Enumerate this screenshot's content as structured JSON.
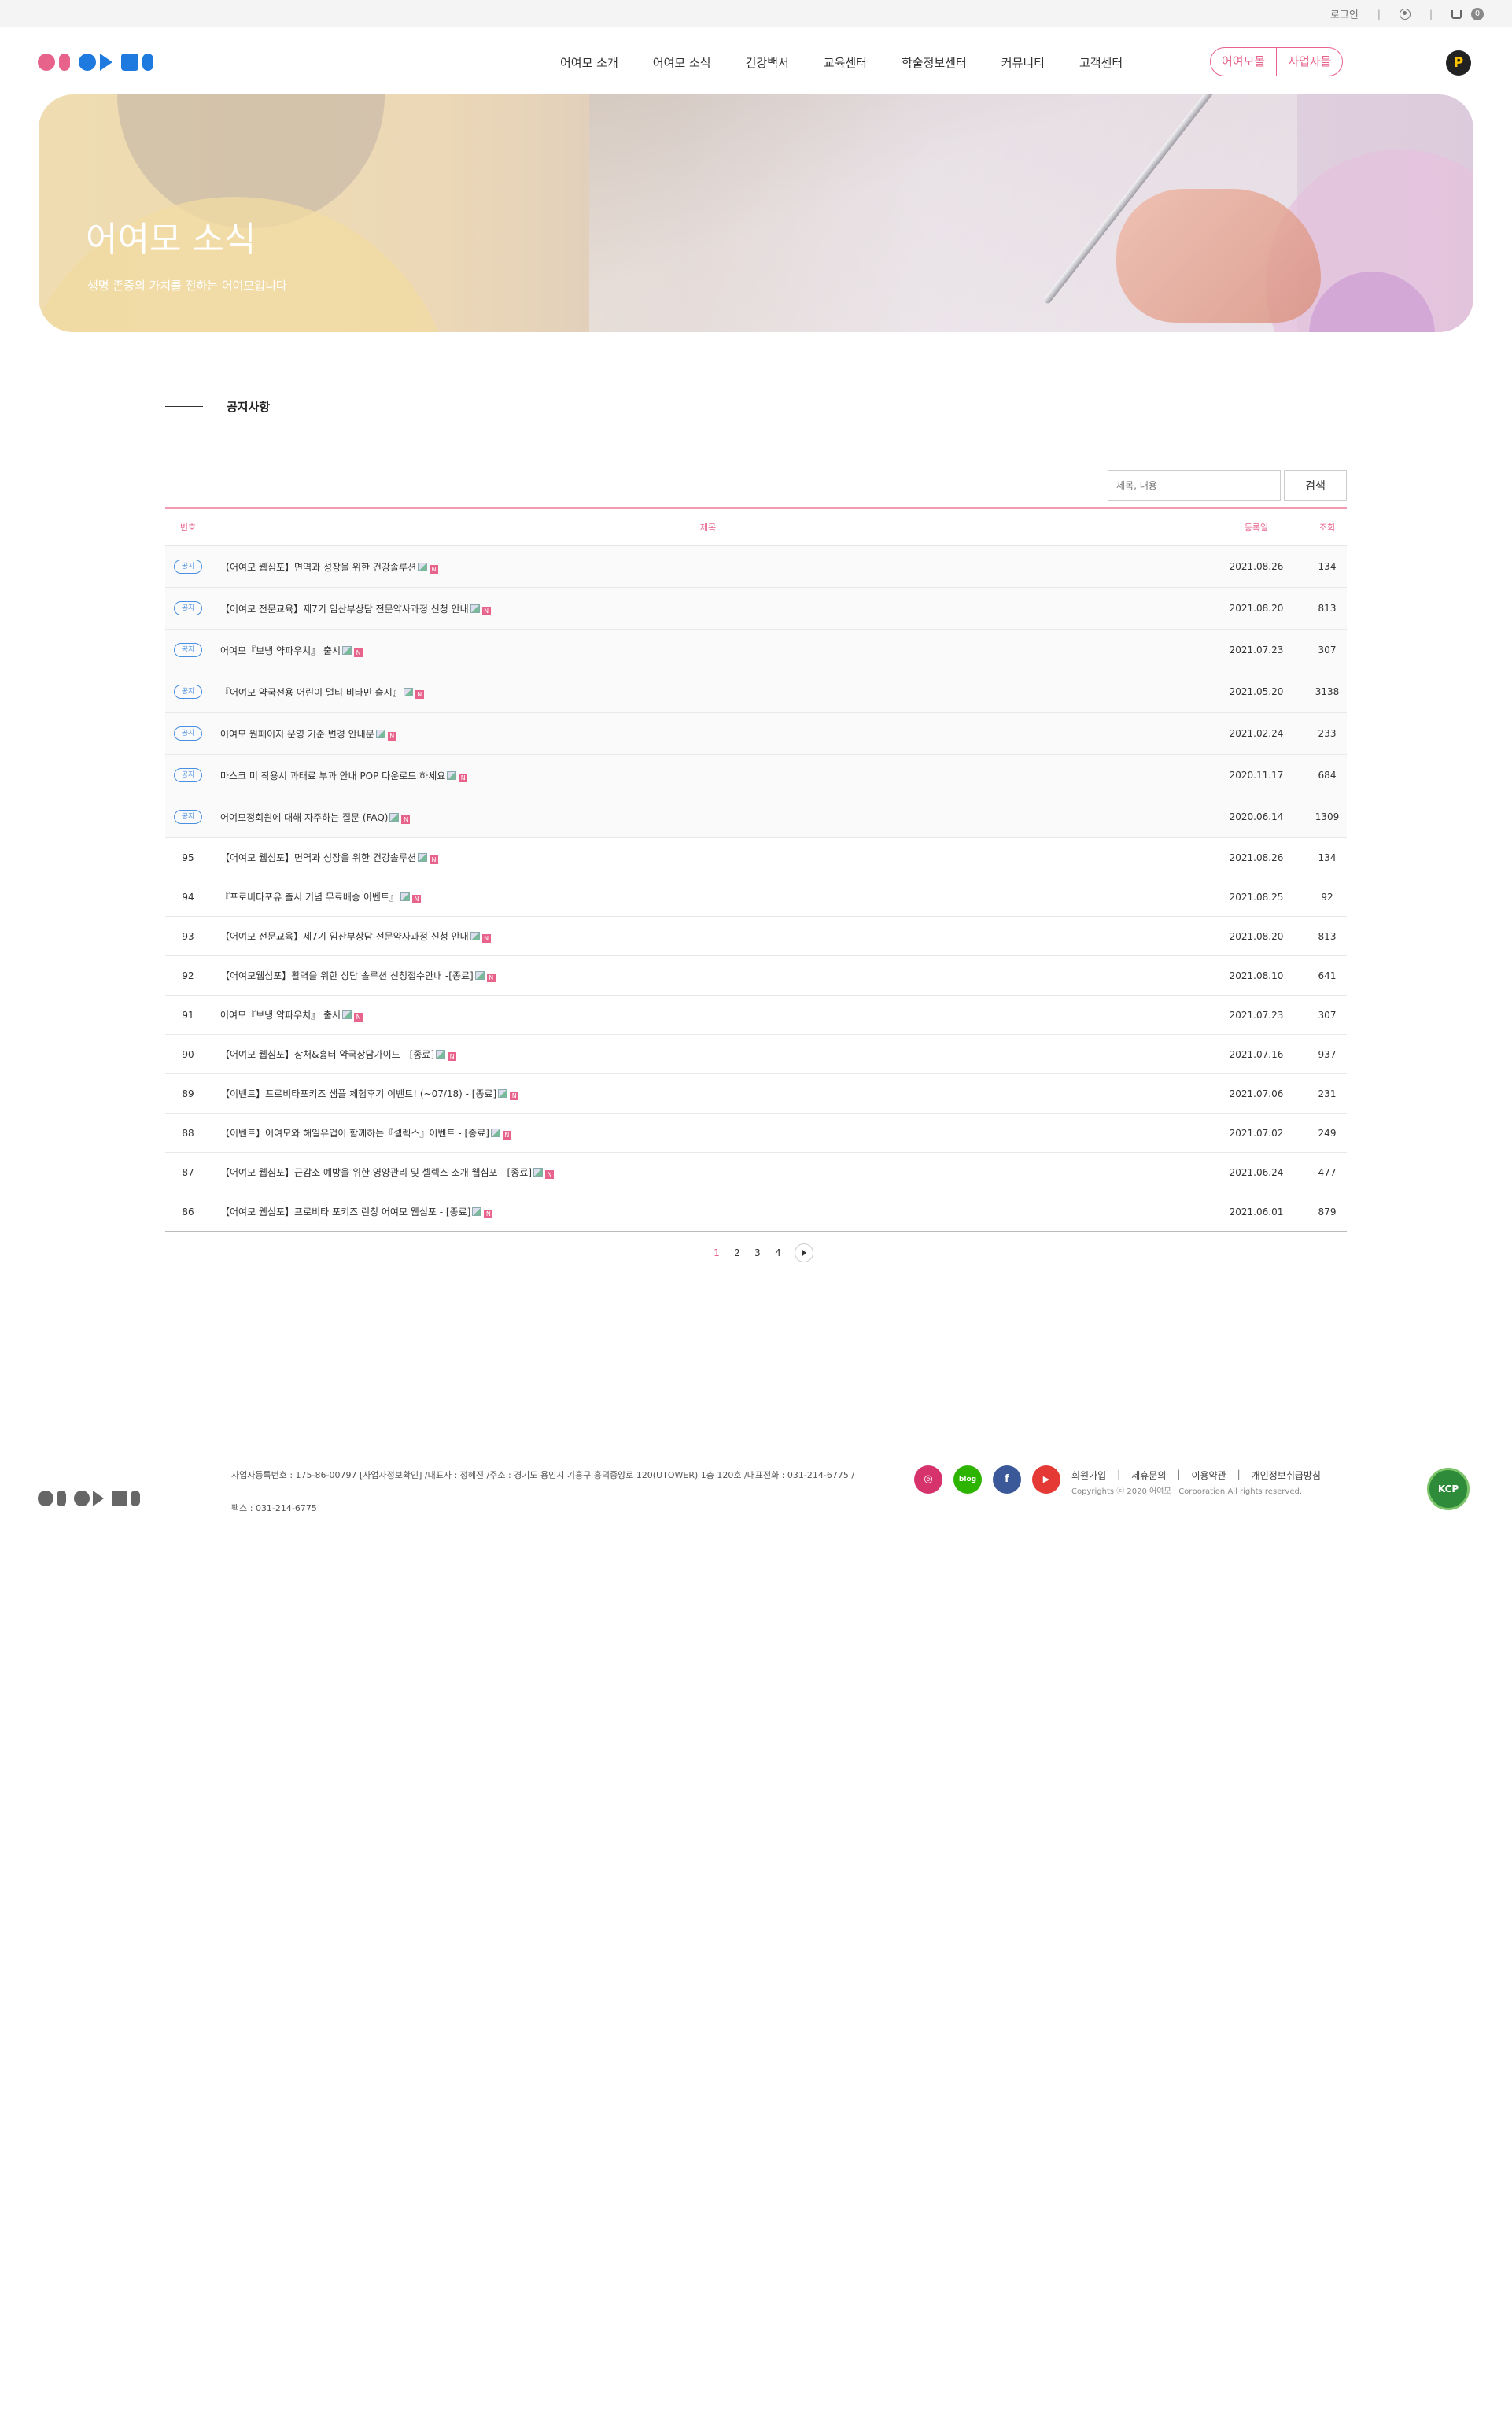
{
  "util": {
    "login": "로그인",
    "cart_count": "0"
  },
  "gnb": [
    "어여모 소개",
    "어여모 소식",
    "건강백서",
    "교육센터",
    "학술정보센터",
    "커뮤니티",
    "고객센터"
  ],
  "mall_buttons": [
    "어여모몰",
    "사업자몰"
  ],
  "point_badge": "P",
  "hero": {
    "title": "어여모 소식",
    "subtitle": "생명 존중의 가치를 전하는 어여모입니다"
  },
  "section_title": "공지사항",
  "search": {
    "placeholder": "제목, 내용",
    "button": "검색"
  },
  "table": {
    "headers": {
      "no": "번호",
      "title": "제목",
      "date": "등록일",
      "hits": "조회"
    },
    "notice_label": "공지",
    "notices": [
      {
        "title": "【어여모 웹심포】면역과 성장을 위한 건강솔루션",
        "date": "2021.08.26",
        "hits": "134"
      },
      {
        "title": "【어여모 전문교육】제7기 임산부상담 전문약사과정 신청 안내",
        "date": "2021.08.20",
        "hits": "813"
      },
      {
        "title": "어여모『보냉 약파우치』 출시",
        "date": "2021.07.23",
        "hits": "307"
      },
      {
        "title": "『어여모 약국전용 어린이 멀티 비타민 출시』",
        "date": "2021.05.20",
        "hits": "3138"
      },
      {
        "title": "어여모 원페이지 운영 기준 변경 안내문",
        "date": "2021.02.24",
        "hits": "233"
      },
      {
        "title": "마스크 미 착용시 과태료 부과 안내 POP 다운로드 하세요",
        "date": "2020.11.17",
        "hits": "684"
      },
      {
        "title": "어여모정회원에 대해 자주하는 질문 (FAQ)",
        "date": "2020.06.14",
        "hits": "1309"
      }
    ],
    "rows": [
      {
        "no": "95",
        "title": "【어여모 웹심포】면역과 성장을 위한 건강솔루션",
        "date": "2021.08.26",
        "hits": "134"
      },
      {
        "no": "94",
        "title": "『프로비타포유 출시 기념 무료배송 이벤트』",
        "date": "2021.08.25",
        "hits": "92"
      },
      {
        "no": "93",
        "title": "【어여모 전문교육】제7기 임산부상담 전문약사과정 신청 안내",
        "date": "2021.08.20",
        "hits": "813"
      },
      {
        "no": "92",
        "title": "【어여모웹심포】활력을 위한 상담 솔루션 신청접수안내 -[종료]",
        "date": "2021.08.10",
        "hits": "641"
      },
      {
        "no": "91",
        "title": "어여모『보냉 약파우치』 출시",
        "date": "2021.07.23",
        "hits": "307"
      },
      {
        "no": "90",
        "title": "【어여모 웹심포】상처&흉터 약국상담가이드 - [종료]",
        "date": "2021.07.16",
        "hits": "937"
      },
      {
        "no": "89",
        "title": "【이벤트】프로비타포키즈 샘플 체험후기 이벤트! (~07/18) - [종료]",
        "date": "2021.07.06",
        "hits": "231"
      },
      {
        "no": "88",
        "title": "【이벤트】어여모와 해일유업이 함께하는『셀렉스』이벤트 - [종료]",
        "date": "2021.07.02",
        "hits": "249"
      },
      {
        "no": "87",
        "title": "【어여모 웹심포】근감소 예방을 위한 영양관리 및 셀렉스 소개 웹심포 - [종료]",
        "date": "2021.06.24",
        "hits": "477"
      },
      {
        "no": "86",
        "title": "【어여모 웹심포】프로비타 포키즈 런칭 어여모 웹심포 - [종료]",
        "date": "2021.06.01",
        "hits": "879"
      }
    ]
  },
  "pagination": {
    "pages": [
      "1",
      "2",
      "3",
      "4"
    ],
    "current": "1"
  },
  "footer": {
    "info": "사업자등록번호 : 175-86-00797 [사업자정보확인] /대표자 : 정혜진 /주소 : 경기도 용인시 기흥구 흥덕중앙로 120(UTOWER) 1층 120호 /대표전화 : 031-214-6775 /",
    "fax": "팩스 : 031-214-6775",
    "links": [
      "회원가입",
      "제휴문의",
      "이용약관",
      "개인정보취급방침"
    ],
    "copyright": "Copyrights ⓒ 2020 어여모 . Corporation All rights reserved.",
    "socials": [
      {
        "name": "instagram",
        "glyph": "◎",
        "color": "#d6336c"
      },
      {
        "name": "blog",
        "glyph": "blog",
        "color": "#2db400"
      },
      {
        "name": "facebook",
        "glyph": "f",
        "color": "#3b5998"
      },
      {
        "name": "youtube",
        "glyph": "▶",
        "color": "#e53935"
      }
    ],
    "kcp": "KCP"
  },
  "colors": {
    "accent": "#e8638b",
    "notice_blue": "#4a90e2",
    "logo_pink": "#e8638b",
    "logo_blue": "#1f7ae0"
  }
}
